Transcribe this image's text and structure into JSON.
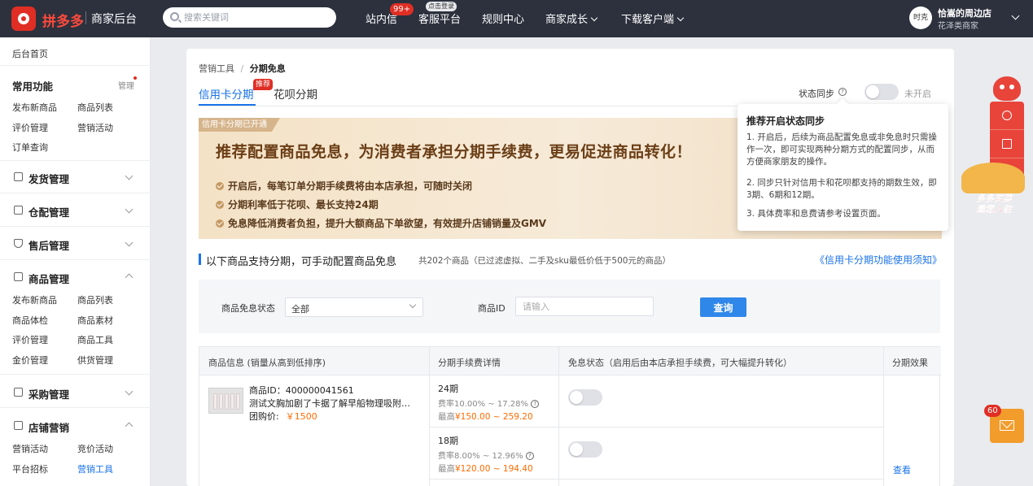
{
  "header": {
    "brand": "拼多多",
    "subtitle": "商家后台",
    "search_placeholder": "搜索关键词",
    "nav": [
      {
        "label": "站内信",
        "badge": "99+"
      },
      {
        "label": "客服平台",
        "badge": "点击登录"
      },
      {
        "label": "规则中心"
      },
      {
        "label": "商家成长"
      },
      {
        "label": "下载客户端"
      }
    ],
    "user": {
      "avatar": "时克",
      "shop_name": "恰嵩的周边店",
      "shop_type": "花泽类商家"
    }
  },
  "sidebar": {
    "home": "后台首页",
    "common": {
      "title": "常用功能",
      "manage": "管理",
      "items": [
        "发布新商品",
        "商品列表",
        "评价管理",
        "营销活动",
        "订单查询"
      ]
    },
    "groups": [
      {
        "title": "发货管理",
        "items": []
      },
      {
        "title": "仓配管理",
        "items": []
      },
      {
        "title": "售后管理",
        "items": []
      },
      {
        "title": "商品管理",
        "items": [
          "发布新商品",
          "商品列表",
          "商品体检",
          "商品素材",
          "评价管理",
          "商品工具",
          "金价管理",
          "供货管理"
        ]
      },
      {
        "title": "采购管理",
        "items": []
      },
      {
        "title": "店铺营销",
        "items": [
          "营销活动",
          "竞价活动",
          "平台招标",
          "营销工具"
        ]
      }
    ]
  },
  "main": {
    "breadcrumb": {
      "parent": "营销工具",
      "sep": "/",
      "current": "分期免息"
    },
    "tabs": [
      {
        "label": "信用卡分期",
        "badge": "推荐"
      },
      {
        "label": "花呗分期"
      }
    ],
    "sync": {
      "label": "状态同步",
      "status": "未开启"
    },
    "banner": {
      "tag": "信用卡分期已开通",
      "title": "推荐配置商品免息，为消费者承担分期手续费，更易促进商品转化！",
      "points": [
        "开启后，每笔订单分期手续费将由本店承担，可随时关闭",
        "分期利率低于花呗、最长支持24期",
        "免息降低消费者负担，提升大额商品下单欲望，有效提升店铺销量及GMV"
      ]
    },
    "section": {
      "title": "以下商品支持分期，可手动配置商品免息",
      "note": "共202个商品（已过滤虚拟、二手及sku最低价低于500元的商品）",
      "link": "《信用卡分期功能使用须知》"
    },
    "filter": {
      "status_label": "商品免息状态",
      "status_value": "全部",
      "id_label": "商品ID",
      "id_placeholder": "请输入",
      "query_button": "查询"
    },
    "table": {
      "headers": [
        "商品信息 (销量从高到低排序)",
        "分期手续费详情",
        "免息状态（启用后由本店承担手续费，可大幅提升转化）",
        "分期效果"
      ],
      "product": {
        "id": "商品ID：400000041561",
        "name": "测试文胸加剧了卡据了解早船物理吸附鸡...",
        "price_label": "团购价:",
        "price": "￥1500"
      },
      "periods": [
        {
          "period": "24期",
          "rate": "费率10.00% ~ 17.28%",
          "max_label": "最高",
          "max": "¥150.00 ~ 259.20"
        },
        {
          "period": "18期",
          "rate": "费率8.00% ~ 12.96%",
          "max_label": "最高",
          "max": "¥120.00 ~ 194.40"
        }
      ],
      "view_link": "查看"
    }
  },
  "popover": {
    "title": "推荐开启状态同步",
    "lines": [
      "1. 开启后，后续为商品配置免息或非免息时只需操作一次，即可实现两种分期方式的配置同步，从而方便商家朋友的操作。",
      "2. 同步只针对信用卡和花呗都支持的期数生效，即3期、6期和12期。",
      "3. 具体费率和息费请参考设置页面。"
    ]
  },
  "float": {
    "promo_line1": "多多买菜",
    "promo_line2": "邀您入驻",
    "mail_badge": "60"
  }
}
